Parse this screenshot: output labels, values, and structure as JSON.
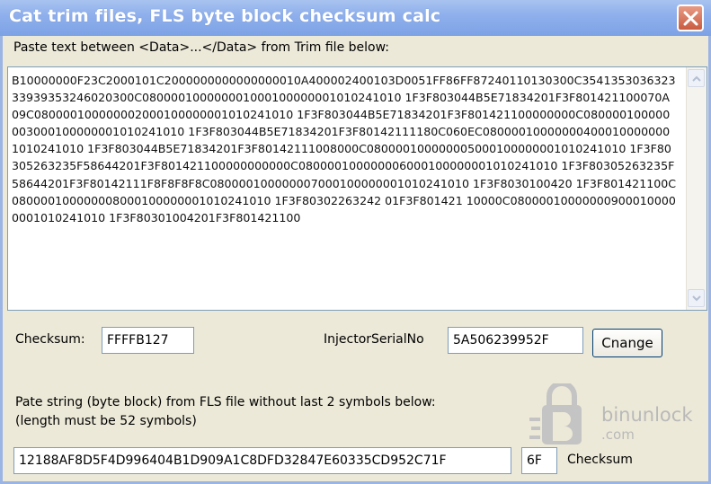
{
  "window": {
    "title": "Cat trim files, FLS byte block checksum calc"
  },
  "trim": {
    "label": "Paste text between <Data>...</Data>  from Trim file below:",
    "data": "B10000000F23C2000101C2000000000000000010A400002400103D0051FF86FF87240110130300C354135303632333939353246020300C080000100000001000100000001010241010 1F3F803044B5E71834201F3F801421100070A09C080000100000002000100000001010241010 1F3F803044B5E71834201F3F801421100000000C080000100000003000100000001010241010 1F3F803044B5E71834201F3F80142111180C060EC080000100000004000100000001010241010 1F3F803044B5E71834201F3F80142111008000C080000100000005000100000001010241010 1F3F80305263235F58644201F3F801421100000000000C080000100000006000100000001010241010 1F3F80305263235F58644201F3F80142111F8F8F8F8C080000100000007000100000001010241010 1F3F8030100420 1F3F801421100C080000100000008000100000001010241010 1F3F80302263242 01F3F801421 10000C080000100000009000100000001010241010 1F3F80301004201F3F801421100"
  },
  "checksum": {
    "label": "Checksum:",
    "value": "FFFFB127"
  },
  "injector": {
    "label": "InjectorSerialNo",
    "value": "5A506239952F",
    "button": "Cnange"
  },
  "fls": {
    "label1": "Pate string (byte block) from FLS file without last 2 symbols below:",
    "label2": "(length must be 52 symbols)",
    "value": "12188AF8D5F4D996404B1D909A1C8DFD32847E60335CD952C71F",
    "checksum_value": "6F",
    "checksum_label": "Checksum"
  },
  "watermark": {
    "name": "binunlock",
    "sub": ".com"
  }
}
